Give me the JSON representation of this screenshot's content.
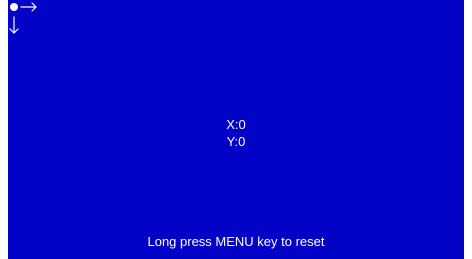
{
  "screen": {
    "background_color": "#0303c8",
    "foreground_color": "#ffffff",
    "icons": {
      "origin": "origin-dot-icon",
      "x_axis": "arrow-right-icon",
      "y_axis": "arrow-down-icon"
    },
    "x_label": "X:0",
    "y_label": "Y:0",
    "hint": "Long press MENU key to reset"
  }
}
